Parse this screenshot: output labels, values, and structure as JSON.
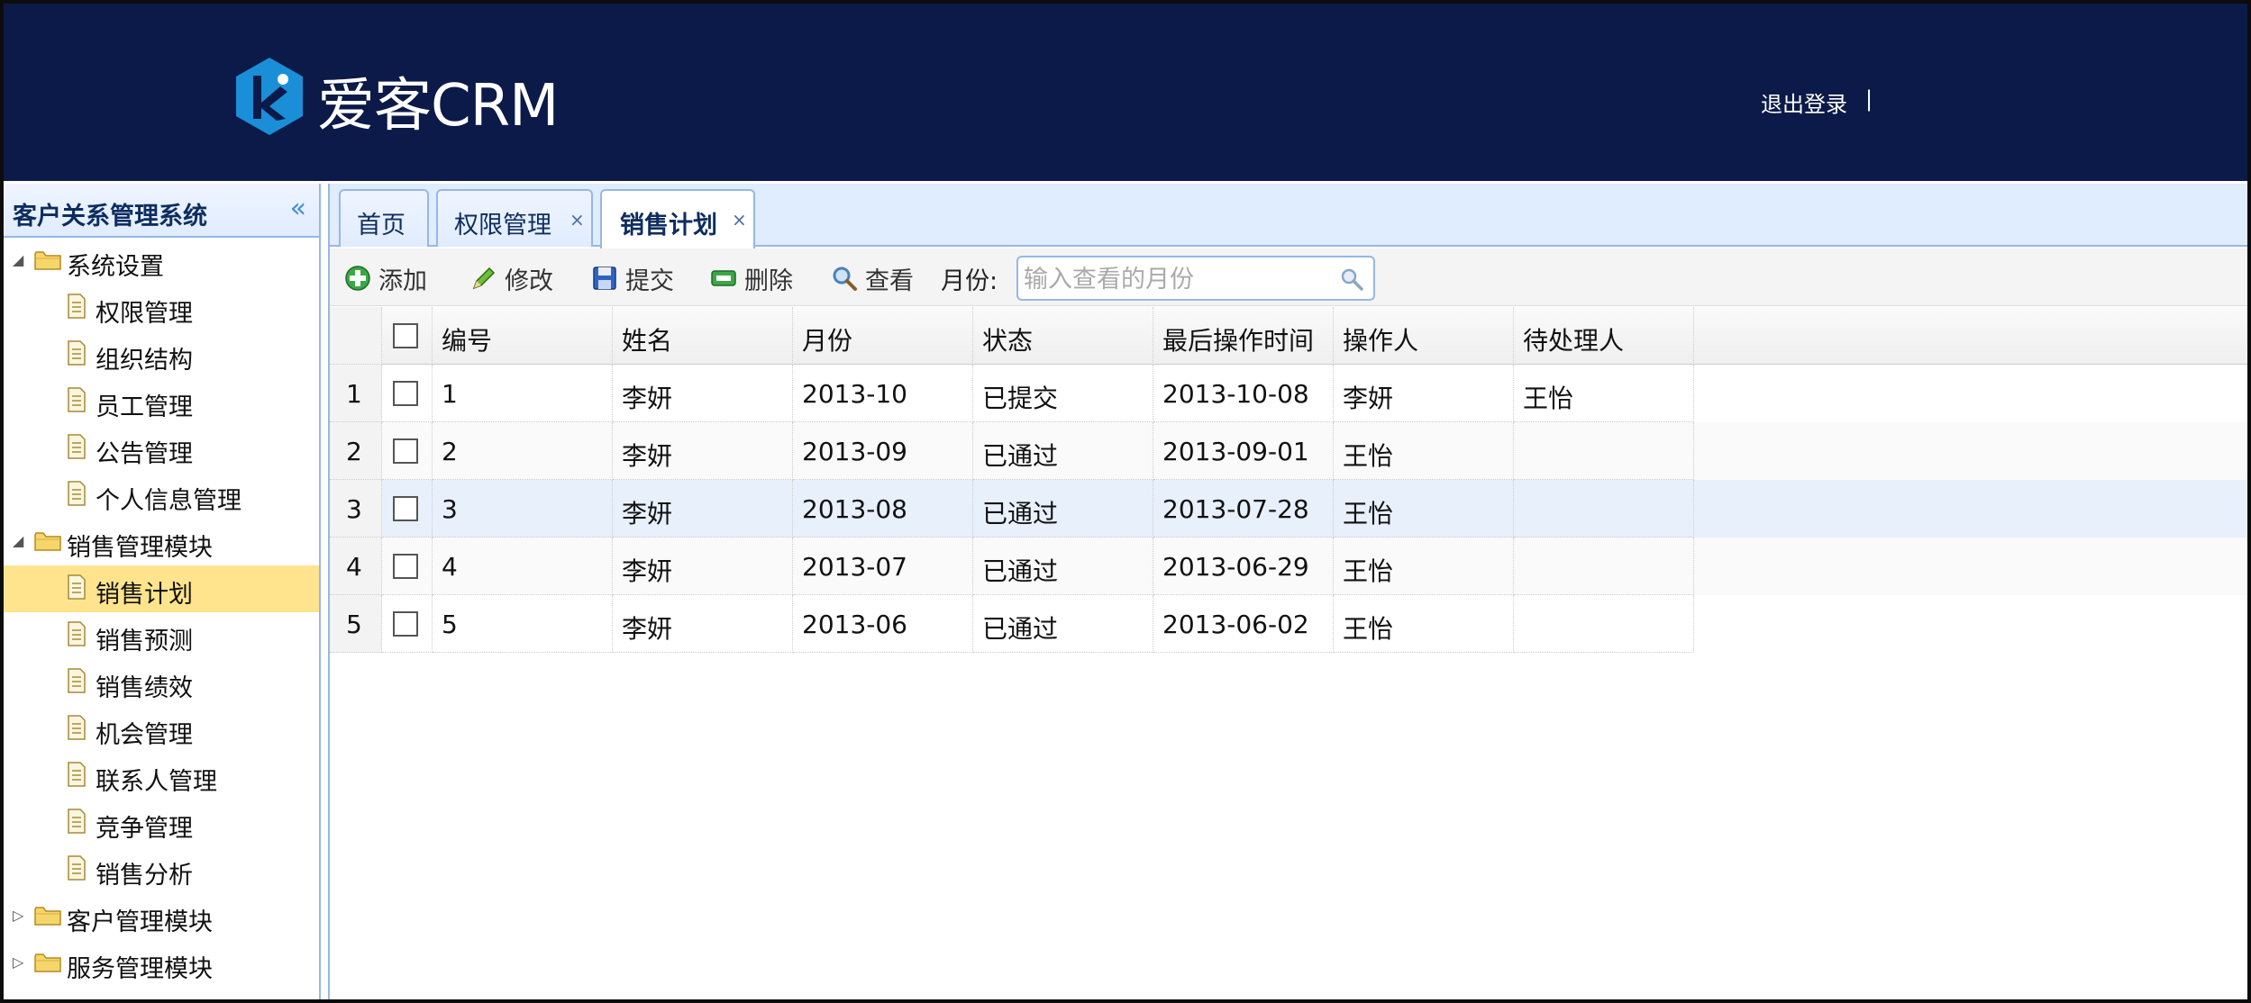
{
  "header": {
    "brand": "爱客CRM",
    "logout": "退出登录",
    "separator": "|"
  },
  "sidebar": {
    "title": "客户关系管理系统",
    "collapse_glyph": "«",
    "tree": [
      {
        "label": "系统设置",
        "type": "folder",
        "expanded": true
      },
      {
        "label": "权限管理",
        "type": "file"
      },
      {
        "label": "组织结构",
        "type": "file"
      },
      {
        "label": "员工管理",
        "type": "file"
      },
      {
        "label": "公告管理",
        "type": "file"
      },
      {
        "label": "个人信息管理",
        "type": "file"
      },
      {
        "label": "销售管理模块",
        "type": "folder",
        "expanded": true
      },
      {
        "label": "销售计划",
        "type": "file",
        "selected": true
      },
      {
        "label": "销售预测",
        "type": "file"
      },
      {
        "label": "销售绩效",
        "type": "file"
      },
      {
        "label": "机会管理",
        "type": "file"
      },
      {
        "label": "联系人管理",
        "type": "file"
      },
      {
        "label": "竞争管理",
        "type": "file"
      },
      {
        "label": "销售分析",
        "type": "file"
      },
      {
        "label": "客户管理模块",
        "type": "folder",
        "expanded": false
      },
      {
        "label": "服务管理模块",
        "type": "folder",
        "expanded": false
      }
    ]
  },
  "tabs": [
    {
      "label": "首页",
      "closable": false,
      "active": false
    },
    {
      "label": "权限管理",
      "closable": true,
      "active": false
    },
    {
      "label": "销售计划",
      "closable": true,
      "active": true
    }
  ],
  "tab_close_glyph": "×",
  "toolbar": {
    "add": "添加",
    "edit": "修改",
    "submit": "提交",
    "delete": "删除",
    "view": "查看",
    "month_label": "月份:",
    "month_placeholder": "输入查看的月份"
  },
  "grid": {
    "columns": [
      "编号",
      "姓名",
      "月份",
      "状态",
      "最后操作时间",
      "操作人",
      "待处理人"
    ],
    "rows": [
      {
        "rownum": "1",
        "cells": [
          "1",
          "李妍",
          "2013-10",
          "已提交",
          "2013-10-08",
          "李妍",
          "王怡"
        ]
      },
      {
        "rownum": "2",
        "cells": [
          "2",
          "李妍",
          "2013-09",
          "已通过",
          "2013-09-01",
          "王怡",
          ""
        ]
      },
      {
        "rownum": "3",
        "cells": [
          "3",
          "李妍",
          "2013-08",
          "已通过",
          "2013-07-28",
          "王怡",
          ""
        ]
      },
      {
        "rownum": "4",
        "cells": [
          "4",
          "李妍",
          "2013-07",
          "已通过",
          "2013-06-29",
          "王怡",
          ""
        ]
      },
      {
        "rownum": "5",
        "cells": [
          "5",
          "李妍",
          "2013-06",
          "已通过",
          "2013-06-02",
          "王怡",
          ""
        ]
      }
    ]
  },
  "colors": {
    "header_bg": "#0b1a48",
    "panel_border": "#95b8e7",
    "selected_node": "#ffe48d",
    "highlight_row": "#e8f0fc",
    "logo": "#1a8fd8"
  }
}
